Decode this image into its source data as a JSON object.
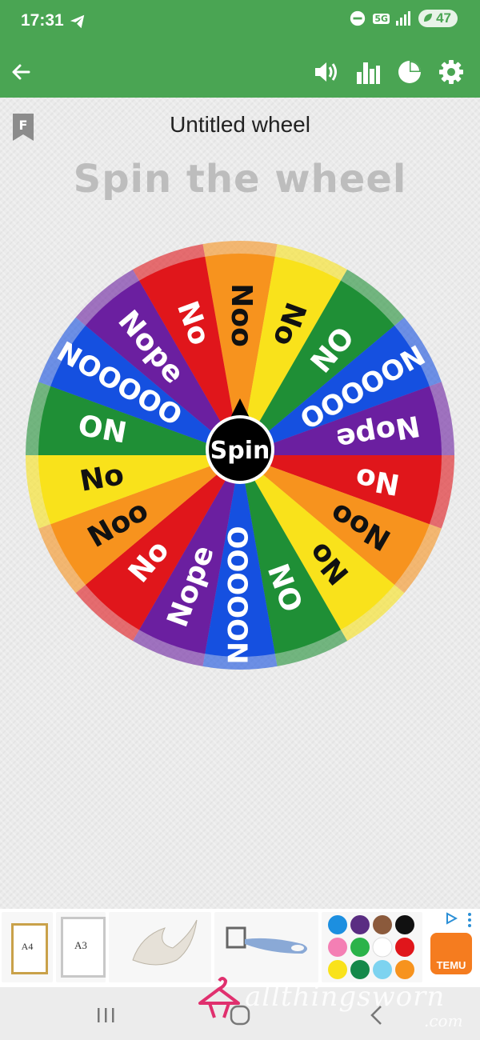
{
  "status_bar": {
    "time": "17:31",
    "network": "5G",
    "battery": "47"
  },
  "toolbar": {
    "back_icon": "arrow-left-icon",
    "sound_icon": "volume-icon",
    "stats_icon": "bar-chart-icon",
    "pie_icon": "pie-chart-icon",
    "settings_icon": "gear-icon"
  },
  "page": {
    "bookmark_letter": "F",
    "wheel_title": "Untitled wheel",
    "headline": "Spin the wheel",
    "spin_label": "Spin"
  },
  "wheel": {
    "segments": [
      {
        "label": "Noo",
        "color": "#f7931e",
        "text_color": "#111111"
      },
      {
        "label": "No",
        "color": "#f9e21b",
        "text_color": "#111111"
      },
      {
        "label": "ON",
        "color": "#1f8f36",
        "text_color": "#ffffff"
      },
      {
        "label": "NOOOOO",
        "color": "#1550e0",
        "text_color": "#ffffff"
      },
      {
        "label": "Nope",
        "color": "#6b1fa0",
        "text_color": "#ffffff"
      },
      {
        "label": "No",
        "color": "#e0161b",
        "text_color": "#ffffff"
      },
      {
        "label": "Noo",
        "color": "#f7931e",
        "text_color": "#111111"
      },
      {
        "label": "No",
        "color": "#f9e21b",
        "text_color": "#111111"
      },
      {
        "label": "ON",
        "color": "#1f8f36",
        "text_color": "#ffffff"
      },
      {
        "label": "NOOOOO",
        "color": "#1550e0",
        "text_color": "#ffffff"
      },
      {
        "label": "Nope",
        "color": "#6b1fa0",
        "text_color": "#ffffff"
      },
      {
        "label": "No",
        "color": "#e0161b",
        "text_color": "#ffffff"
      },
      {
        "label": "Noo",
        "color": "#f7931e",
        "text_color": "#111111"
      },
      {
        "label": "No",
        "color": "#f9e21b",
        "text_color": "#111111"
      },
      {
        "label": "ON",
        "color": "#1f8f36",
        "text_color": "#ffffff"
      },
      {
        "label": "NOOOOO",
        "color": "#1550e0",
        "text_color": "#ffffff"
      },
      {
        "label": "Nope",
        "color": "#6b1fa0",
        "text_color": "#ffffff"
      },
      {
        "label": "No",
        "color": "#e0161b",
        "text_color": "#ffffff"
      }
    ]
  },
  "ad": {
    "items": [
      {
        "caption": "A4"
      },
      {
        "caption": "A3"
      },
      {
        "caption": ""
      },
      {
        "caption": ""
      },
      {
        "caption": ""
      }
    ],
    "brand": "TEMU"
  },
  "watermark": {
    "text": "allthingsworn",
    "sub": ".com"
  },
  "colors": {
    "accent": "#4aa553",
    "background": "#ebebeb"
  }
}
